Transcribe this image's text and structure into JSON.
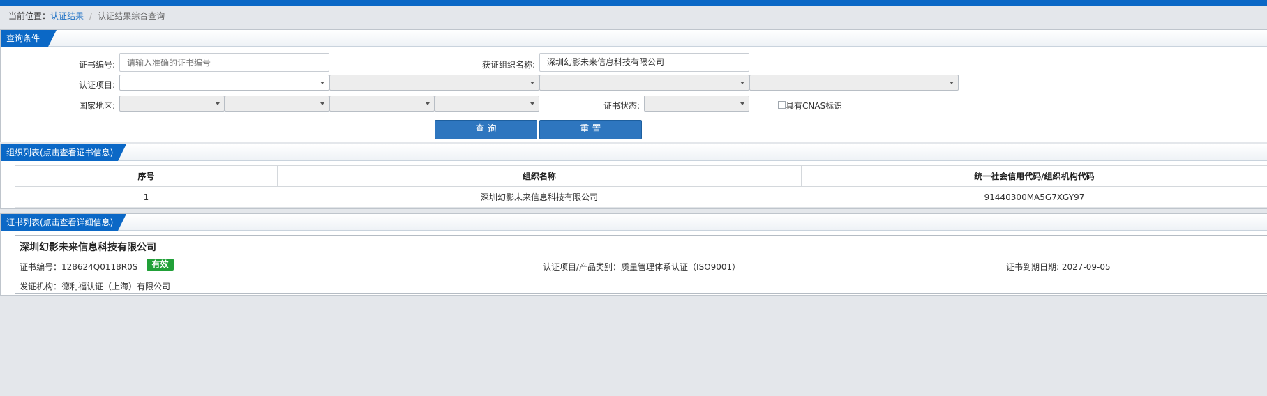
{
  "breadcrumb": {
    "prefix": "当前位置：",
    "link": "认证结果",
    "separator": "/",
    "current": "认证结果综合查询"
  },
  "query_panel": {
    "title": "查询条件",
    "cert_no_label": "证书编号:",
    "cert_no_placeholder": "请输入准确的证书编号",
    "org_label": "获证组织名称:",
    "org_value": "深圳幻影未来信息科技有限公司",
    "cert_item_label": "认证项目:",
    "region_label": "国家地区:",
    "status_label": "证书状态:",
    "cnas_label": "具有CNAS标识",
    "search_button": "查 询",
    "reset_button": "重 置"
  },
  "org_panel": {
    "title": "组织列表(点击查看证书信息)",
    "columns": [
      "序号",
      "组织名称",
      "统一社会信用代码/组织机构代码"
    ],
    "rows": [
      [
        "1",
        "深圳幻影未来信息科技有限公司",
        "91440300MA5G7XGY97"
      ]
    ]
  },
  "cert_panel": {
    "title": "证书列表(点击查看详细信息)",
    "card": {
      "company": "深圳幻影未来信息科技有限公司",
      "cert_no": "证书编号：128624Q0118R0S",
      "status": "有效",
      "item": "认证项目/产品类别：质量管理体系认证（ISO9001）",
      "expiry": "证书到期日期: 2027-09-05",
      "issuer": "发证机构：德利福认证（上海）有限公司"
    }
  },
  "colors": {
    "accent": "#0b68c6",
    "button": "#2e76bf",
    "status_valid": "#21a038",
    "background": "#e4e7eb"
  }
}
